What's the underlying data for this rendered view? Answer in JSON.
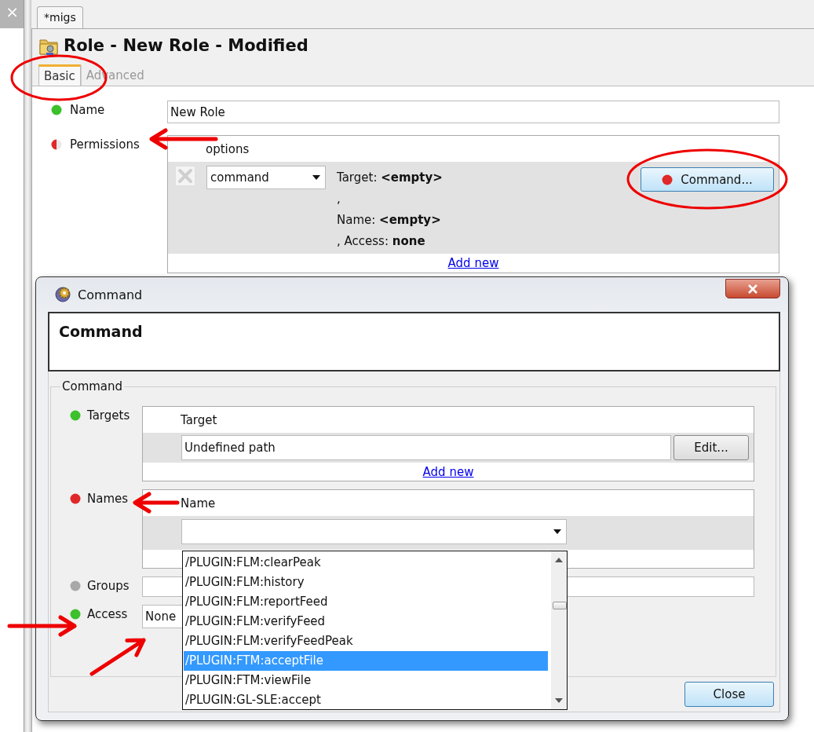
{
  "side_panel": {
    "close_glyph": "×"
  },
  "editor_tabs": [
    {
      "label": "*migs",
      "selected": true
    }
  ],
  "editor": {
    "title": "Role - New Role - Modified",
    "tabs": [
      {
        "label": "Basic",
        "selected": true
      },
      {
        "label": "Advanced",
        "selected": false
      }
    ],
    "fields": [
      {
        "kind": "text",
        "label": "Name",
        "color": "#3cc02c",
        "value": "New Role"
      },
      {
        "kind": "list",
        "label": "Permissions",
        "color": "#e02828",
        "partial": true,
        "header": "options",
        "rows": [
          {
            "type": "command",
            "summary": [
              "Target: **<empty>**",
              ",",
              "Name: **<empty>**",
              ", Access: **none**"
            ],
            "button": {
              "label": "Command...",
              "color": "#e02828"
            }
          }
        ],
        "add_link": "Add new"
      }
    ]
  },
  "dialog": {
    "title": "Command",
    "heading": "Command",
    "group": "Command",
    "fields": [
      {
        "kind": "paths",
        "label": "Targets",
        "color": "#3cc02c",
        "header": "Target",
        "rows": [
          {
            "value": "Undefined path",
            "button": "Edit..."
          }
        ],
        "add_link": "Add new"
      },
      {
        "kind": "combo",
        "label": "Names",
        "color": "#e02828",
        "header": "Name"
      },
      {
        "kind": "text",
        "label": "Groups",
        "color": "#a8a8a8"
      },
      {
        "kind": "short",
        "label": "Access",
        "color": "#3cc02c",
        "value": "None"
      }
    ],
    "dropdown": {
      "items": [
        {
          "label": "/PLUGIN:FLM:clearPeak",
          "selected": false
        },
        {
          "label": "/PLUGIN:FLM:history",
          "selected": false
        },
        {
          "label": "/PLUGIN:FLM:reportFeed",
          "selected": false
        },
        {
          "label": "/PLUGIN:FLM:verifyFeed",
          "selected": false
        },
        {
          "label": "/PLUGIN:FLM:verifyFeedPeak",
          "selected": false
        },
        {
          "label": "/PLUGIN:FTM:acceptFile",
          "selected": true
        },
        {
          "label": "/PLUGIN:FTM:viewFile",
          "selected": false
        },
        {
          "label": "/PLUGIN:GL-SLE:accept",
          "selected": false
        }
      ]
    },
    "close_button": "Close"
  },
  "annotations": [
    {
      "kind": "ellipse"
    },
    {
      "kind": "arrow"
    },
    {
      "kind": "ellipse"
    },
    {
      "kind": "arrow"
    },
    {
      "kind": "arrow"
    },
    {
      "kind": "arrow"
    }
  ]
}
